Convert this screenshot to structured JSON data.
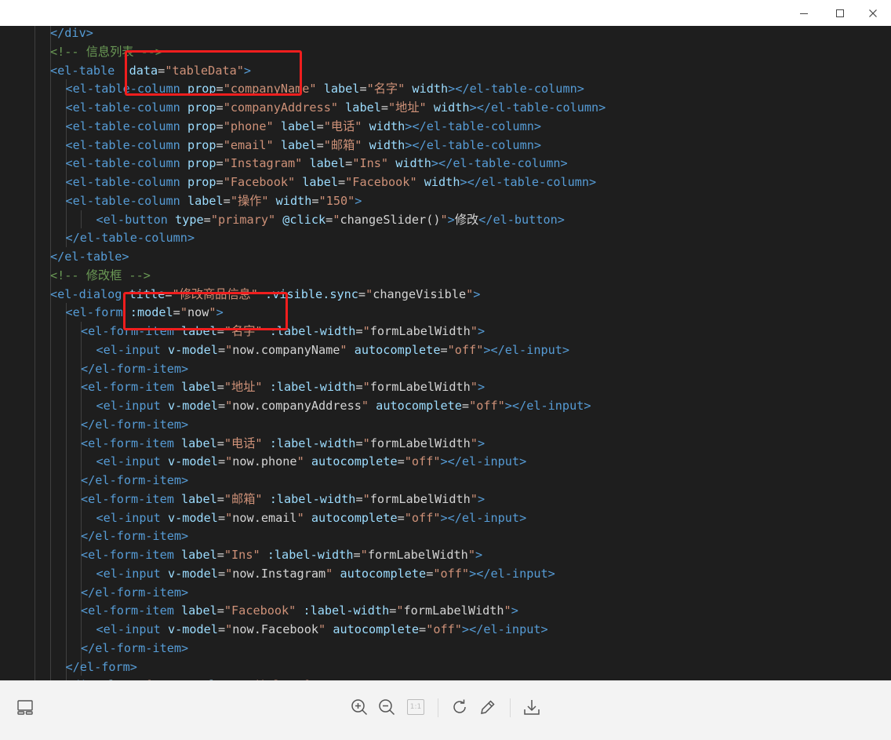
{
  "window": {
    "minimize_glyph": "—",
    "maximize_glyph": "☐",
    "close_glyph": "✕"
  },
  "code": {
    "lines": [
      {
        "indent": 2,
        "tokens": [
          [
            "t",
            "</div>"
          ]
        ]
      },
      {
        "indent": 2,
        "tokens": [
          [
            "c",
            "<!-- 信息列表 -->"
          ]
        ]
      },
      {
        "indent": 2,
        "tokens": [
          [
            "t",
            "<el-table "
          ],
          [
            "a",
            ":data"
          ],
          [
            "x",
            "="
          ],
          [
            "s",
            "\"tableData\""
          ],
          [
            "t",
            ">"
          ]
        ]
      },
      {
        "indent": 3,
        "tokens": [
          [
            "t",
            "<el-table-column "
          ],
          [
            "a",
            "prop"
          ],
          [
            "x",
            "="
          ],
          [
            "s",
            "\"companyName\""
          ],
          [
            "x",
            " "
          ],
          [
            "a",
            "label"
          ],
          [
            "x",
            "="
          ],
          [
            "s",
            "\"名字\""
          ],
          [
            "x",
            " "
          ],
          [
            "a",
            "width"
          ],
          [
            "t",
            "></el-table-column>"
          ]
        ]
      },
      {
        "indent": 3,
        "tokens": [
          [
            "t",
            "<el-table-column "
          ],
          [
            "a",
            "prop"
          ],
          [
            "x",
            "="
          ],
          [
            "s",
            "\"companyAddress\""
          ],
          [
            "x",
            " "
          ],
          [
            "a",
            "label"
          ],
          [
            "x",
            "="
          ],
          [
            "s",
            "\"地址\""
          ],
          [
            "x",
            " "
          ],
          [
            "a",
            "width"
          ],
          [
            "t",
            "></el-table-column>"
          ]
        ]
      },
      {
        "indent": 3,
        "tokens": [
          [
            "t",
            "<el-table-column "
          ],
          [
            "a",
            "prop"
          ],
          [
            "x",
            "="
          ],
          [
            "s",
            "\"phone\""
          ],
          [
            "x",
            " "
          ],
          [
            "a",
            "label"
          ],
          [
            "x",
            "="
          ],
          [
            "s",
            "\"电话\""
          ],
          [
            "x",
            " "
          ],
          [
            "a",
            "width"
          ],
          [
            "t",
            "></el-table-column>"
          ]
        ]
      },
      {
        "indent": 3,
        "tokens": [
          [
            "t",
            "<el-table-column "
          ],
          [
            "a",
            "prop"
          ],
          [
            "x",
            "="
          ],
          [
            "s",
            "\"email\""
          ],
          [
            "x",
            " "
          ],
          [
            "a",
            "label"
          ],
          [
            "x",
            "="
          ],
          [
            "s",
            "\"邮箱\""
          ],
          [
            "x",
            " "
          ],
          [
            "a",
            "width"
          ],
          [
            "t",
            "></el-table-column>"
          ]
        ]
      },
      {
        "indent": 3,
        "tokens": [
          [
            "t",
            "<el-table-column "
          ],
          [
            "a",
            "prop"
          ],
          [
            "x",
            "="
          ],
          [
            "s",
            "\"Instagram\""
          ],
          [
            "x",
            " "
          ],
          [
            "a",
            "label"
          ],
          [
            "x",
            "="
          ],
          [
            "s",
            "\"Ins\""
          ],
          [
            "x",
            " "
          ],
          [
            "a",
            "width"
          ],
          [
            "t",
            "></el-table-column>"
          ]
        ]
      },
      {
        "indent": 3,
        "tokens": [
          [
            "t",
            "<el-table-column "
          ],
          [
            "a",
            "prop"
          ],
          [
            "x",
            "="
          ],
          [
            "s",
            "\"Facebook\""
          ],
          [
            "x",
            " "
          ],
          [
            "a",
            "label"
          ],
          [
            "x",
            "="
          ],
          [
            "s",
            "\"Facebook\""
          ],
          [
            "x",
            " "
          ],
          [
            "a",
            "width"
          ],
          [
            "t",
            "></el-table-column>"
          ]
        ]
      },
      {
        "indent": 3,
        "tokens": [
          [
            "t",
            "<el-table-column "
          ],
          [
            "a",
            "label"
          ],
          [
            "x",
            "="
          ],
          [
            "s",
            "\"操作\""
          ],
          [
            "x",
            " "
          ],
          [
            "a",
            "width"
          ],
          [
            "x",
            "="
          ],
          [
            "s",
            "\"150\""
          ],
          [
            "t",
            ">"
          ]
        ]
      },
      {
        "indent": 5,
        "tokens": [
          [
            "t",
            "<el-button "
          ],
          [
            "a",
            "type"
          ],
          [
            "x",
            "="
          ],
          [
            "s",
            "\"primary\""
          ],
          [
            "x",
            " "
          ],
          [
            "a",
            "@click"
          ],
          [
            "x",
            "="
          ],
          [
            "s",
            "\""
          ],
          [
            "x",
            "changeSlider()"
          ],
          [
            "s",
            "\""
          ],
          [
            "t",
            ">"
          ],
          [
            "x",
            "修改"
          ],
          [
            "t",
            "</el-button>"
          ]
        ]
      },
      {
        "indent": 3,
        "tokens": [
          [
            "t",
            "</el-table-column>"
          ]
        ]
      },
      {
        "indent": 2,
        "tokens": [
          [
            "t",
            "</el-table>"
          ]
        ]
      },
      {
        "indent": 2,
        "tokens": [
          [
            "c",
            "<!-- 修改框 -->"
          ]
        ]
      },
      {
        "indent": 2,
        "tokens": [
          [
            "t",
            "<el-dialog "
          ],
          [
            "a",
            "title"
          ],
          [
            "x",
            "="
          ],
          [
            "s",
            "\"修改商品信息\""
          ],
          [
            "x",
            " "
          ],
          [
            "a",
            ":visible.sync"
          ],
          [
            "x",
            "="
          ],
          [
            "s",
            "\""
          ],
          [
            "x",
            "changeVisible"
          ],
          [
            "s",
            "\""
          ],
          [
            "t",
            ">"
          ]
        ]
      },
      {
        "indent": 3,
        "tokens": [
          [
            "t",
            "<el-form "
          ],
          [
            "a",
            ":model"
          ],
          [
            "x",
            "="
          ],
          [
            "s",
            "\""
          ],
          [
            "x",
            "now"
          ],
          [
            "s",
            "\""
          ],
          [
            "t",
            ">"
          ]
        ]
      },
      {
        "indent": 4,
        "tokens": [
          [
            "t",
            "<el-form-item "
          ],
          [
            "a",
            "label"
          ],
          [
            "x",
            "="
          ],
          [
            "s",
            "\"名字\""
          ],
          [
            "x",
            " "
          ],
          [
            "a",
            ":label-width"
          ],
          [
            "x",
            "="
          ],
          [
            "s",
            "\""
          ],
          [
            "x",
            "formLabelWidth"
          ],
          [
            "s",
            "\""
          ],
          [
            "t",
            ">"
          ]
        ]
      },
      {
        "indent": 5,
        "tokens": [
          [
            "t",
            "<el-input "
          ],
          [
            "a",
            "v-model"
          ],
          [
            "x",
            "="
          ],
          [
            "s",
            "\""
          ],
          [
            "x",
            "now.companyName"
          ],
          [
            "s",
            "\""
          ],
          [
            "x",
            " "
          ],
          [
            "a",
            "autocomplete"
          ],
          [
            "x",
            "="
          ],
          [
            "s",
            "\"off\""
          ],
          [
            "t",
            "></el-input>"
          ]
        ]
      },
      {
        "indent": 4,
        "tokens": [
          [
            "t",
            "</el-form-item>"
          ]
        ]
      },
      {
        "indent": 4,
        "tokens": [
          [
            "t",
            "<el-form-item "
          ],
          [
            "a",
            "label"
          ],
          [
            "x",
            "="
          ],
          [
            "s",
            "\"地址\""
          ],
          [
            "x",
            " "
          ],
          [
            "a",
            ":label-width"
          ],
          [
            "x",
            "="
          ],
          [
            "s",
            "\""
          ],
          [
            "x",
            "formLabelWidth"
          ],
          [
            "s",
            "\""
          ],
          [
            "t",
            ">"
          ]
        ]
      },
      {
        "indent": 5,
        "tokens": [
          [
            "t",
            "<el-input "
          ],
          [
            "a",
            "v-model"
          ],
          [
            "x",
            "="
          ],
          [
            "s",
            "\""
          ],
          [
            "x",
            "now.companyAddress"
          ],
          [
            "s",
            "\""
          ],
          [
            "x",
            " "
          ],
          [
            "a",
            "autocomplete"
          ],
          [
            "x",
            "="
          ],
          [
            "s",
            "\"off\""
          ],
          [
            "t",
            "></el-input>"
          ]
        ]
      },
      {
        "indent": 4,
        "tokens": [
          [
            "t",
            "</el-form-item>"
          ]
        ]
      },
      {
        "indent": 4,
        "tokens": [
          [
            "t",
            "<el-form-item "
          ],
          [
            "a",
            "label"
          ],
          [
            "x",
            "="
          ],
          [
            "s",
            "\"电话\""
          ],
          [
            "x",
            " "
          ],
          [
            "a",
            ":label-width"
          ],
          [
            "x",
            "="
          ],
          [
            "s",
            "\""
          ],
          [
            "x",
            "formLabelWidth"
          ],
          [
            "s",
            "\""
          ],
          [
            "t",
            ">"
          ]
        ]
      },
      {
        "indent": 5,
        "tokens": [
          [
            "t",
            "<el-input "
          ],
          [
            "a",
            "v-model"
          ],
          [
            "x",
            "="
          ],
          [
            "s",
            "\""
          ],
          [
            "x",
            "now.phone"
          ],
          [
            "s",
            "\""
          ],
          [
            "x",
            " "
          ],
          [
            "a",
            "autocomplete"
          ],
          [
            "x",
            "="
          ],
          [
            "s",
            "\"off\""
          ],
          [
            "t",
            "></el-input>"
          ]
        ]
      },
      {
        "indent": 4,
        "tokens": [
          [
            "t",
            "</el-form-item>"
          ]
        ]
      },
      {
        "indent": 4,
        "tokens": [
          [
            "t",
            "<el-form-item "
          ],
          [
            "a",
            "label"
          ],
          [
            "x",
            "="
          ],
          [
            "s",
            "\"邮箱\""
          ],
          [
            "x",
            " "
          ],
          [
            "a",
            ":label-width"
          ],
          [
            "x",
            "="
          ],
          [
            "s",
            "\""
          ],
          [
            "x",
            "formLabelWidth"
          ],
          [
            "s",
            "\""
          ],
          [
            "t",
            ">"
          ]
        ]
      },
      {
        "indent": 5,
        "tokens": [
          [
            "t",
            "<el-input "
          ],
          [
            "a",
            "v-model"
          ],
          [
            "x",
            "="
          ],
          [
            "s",
            "\""
          ],
          [
            "x",
            "now.email"
          ],
          [
            "s",
            "\""
          ],
          [
            "x",
            " "
          ],
          [
            "a",
            "autocomplete"
          ],
          [
            "x",
            "="
          ],
          [
            "s",
            "\"off\""
          ],
          [
            "t",
            "></el-input>"
          ]
        ]
      },
      {
        "indent": 4,
        "tokens": [
          [
            "t",
            "</el-form-item>"
          ]
        ]
      },
      {
        "indent": 4,
        "tokens": [
          [
            "t",
            "<el-form-item "
          ],
          [
            "a",
            "label"
          ],
          [
            "x",
            "="
          ],
          [
            "s",
            "\"Ins\""
          ],
          [
            "x",
            " "
          ],
          [
            "a",
            ":label-width"
          ],
          [
            "x",
            "="
          ],
          [
            "s",
            "\""
          ],
          [
            "x",
            "formLabelWidth"
          ],
          [
            "s",
            "\""
          ],
          [
            "t",
            ">"
          ]
        ]
      },
      {
        "indent": 5,
        "tokens": [
          [
            "t",
            "<el-input "
          ],
          [
            "a",
            "v-model"
          ],
          [
            "x",
            "="
          ],
          [
            "s",
            "\""
          ],
          [
            "x",
            "now.Instagram"
          ],
          [
            "s",
            "\""
          ],
          [
            "x",
            " "
          ],
          [
            "a",
            "autocomplete"
          ],
          [
            "x",
            "="
          ],
          [
            "s",
            "\"off\""
          ],
          [
            "t",
            "></el-input>"
          ]
        ]
      },
      {
        "indent": 4,
        "tokens": [
          [
            "t",
            "</el-form-item>"
          ]
        ]
      },
      {
        "indent": 4,
        "tokens": [
          [
            "t",
            "<el-form-item "
          ],
          [
            "a",
            "label"
          ],
          [
            "x",
            "="
          ],
          [
            "s",
            "\"Facebook\""
          ],
          [
            "x",
            " "
          ],
          [
            "a",
            ":label-width"
          ],
          [
            "x",
            "="
          ],
          [
            "s",
            "\""
          ],
          [
            "x",
            "formLabelWidth"
          ],
          [
            "s",
            "\""
          ],
          [
            "t",
            ">"
          ]
        ]
      },
      {
        "indent": 5,
        "tokens": [
          [
            "t",
            "<el-input "
          ],
          [
            "a",
            "v-model"
          ],
          [
            "x",
            "="
          ],
          [
            "s",
            "\""
          ],
          [
            "x",
            "now.Facebook"
          ],
          [
            "s",
            "\""
          ],
          [
            "x",
            " "
          ],
          [
            "a",
            "autocomplete"
          ],
          [
            "x",
            "="
          ],
          [
            "s",
            "\"off\""
          ],
          [
            "t",
            "></el-input>"
          ]
        ]
      },
      {
        "indent": 4,
        "tokens": [
          [
            "t",
            "</el-form-item>"
          ]
        ]
      },
      {
        "indent": 3,
        "tokens": [
          [
            "t",
            "</el-form>"
          ]
        ]
      },
      {
        "indent": 3,
        "tokens": [
          [
            "t",
            "<div "
          ],
          [
            "a",
            "slot"
          ],
          [
            "x",
            "="
          ],
          [
            "s",
            "\"footer\""
          ],
          [
            "x",
            " "
          ],
          [
            "a",
            "class"
          ],
          [
            "x",
            "="
          ],
          [
            "s",
            "\"dialog-footer\""
          ],
          [
            "t",
            ">"
          ]
        ]
      }
    ]
  },
  "toolbar": {
    "panel_icon": "panel-layout-icon",
    "zoom_in_icon": "zoom-in-icon",
    "zoom_out_icon": "zoom-out-icon",
    "actual_size_label": "1:1",
    "rotate_icon": "rotate-icon",
    "edit_icon": "pencil-icon",
    "download_icon": "download-icon"
  },
  "colors": {
    "highlight_box": "#f01e1e",
    "tag": "#569cd6",
    "attribute": "#9cdcfe",
    "string": "#ce9178",
    "comment": "#6a9955"
  }
}
